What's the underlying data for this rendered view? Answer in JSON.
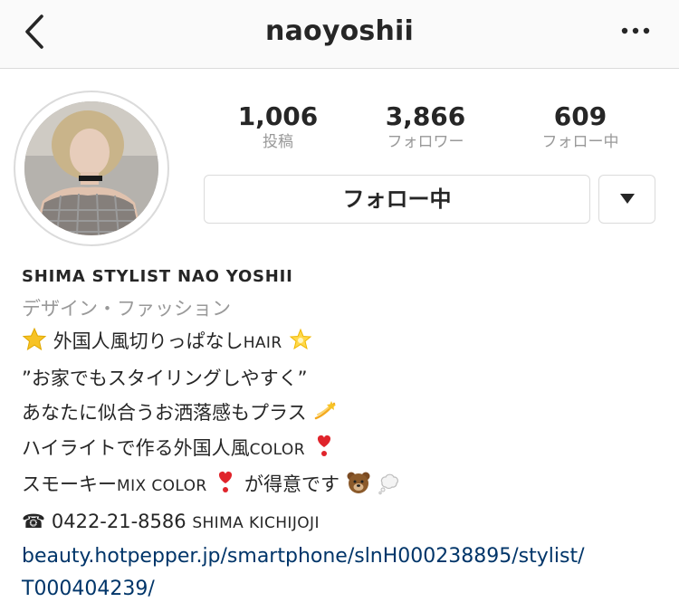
{
  "header": {
    "back_icon": "chevron-left-icon",
    "username": "naoyoshii",
    "more_icon": "ellipsis-icon"
  },
  "stats": [
    {
      "value": "1,006",
      "label": "投稿"
    },
    {
      "value": "3,866",
      "label": "フォロワー"
    },
    {
      "value": "609",
      "label": "フォロー中"
    }
  ],
  "actions": {
    "follow_label": "フォロー中",
    "dropdown_icon": "triangle-down-icon"
  },
  "bio": {
    "name": "SHIMA STYLIST NAO YOSHII",
    "category": "デザイン・ファッション",
    "line1_text": "外国人風切りっぱなし",
    "line1_caps": "HAIR",
    "line2": "”お家でもスタイリングしやすく”",
    "line3": "あなたに似合うお洒落感もプラス",
    "line4_text": "ハイライトで作る外国人風",
    "line4_caps": "COLOR",
    "line5_text1": "スモーキー",
    "line5_caps": "MIX COLOR",
    "line5_text2": "が得意です",
    "phone_glyph": "☎",
    "phone": "0422-21-8586",
    "salon": "SHIMA KICHIJOJI",
    "link_line1": "beauty.hotpepper.jp/smartphone/slnH000238895/stylist/",
    "link_line2": "T000404239/"
  },
  "icons": [
    "star-icon",
    "glowing-star-icon",
    "dizzy-icon",
    "heart-exclamation-icon",
    "bear-icon",
    "thought-bubble-icon",
    "telephone-icon"
  ]
}
